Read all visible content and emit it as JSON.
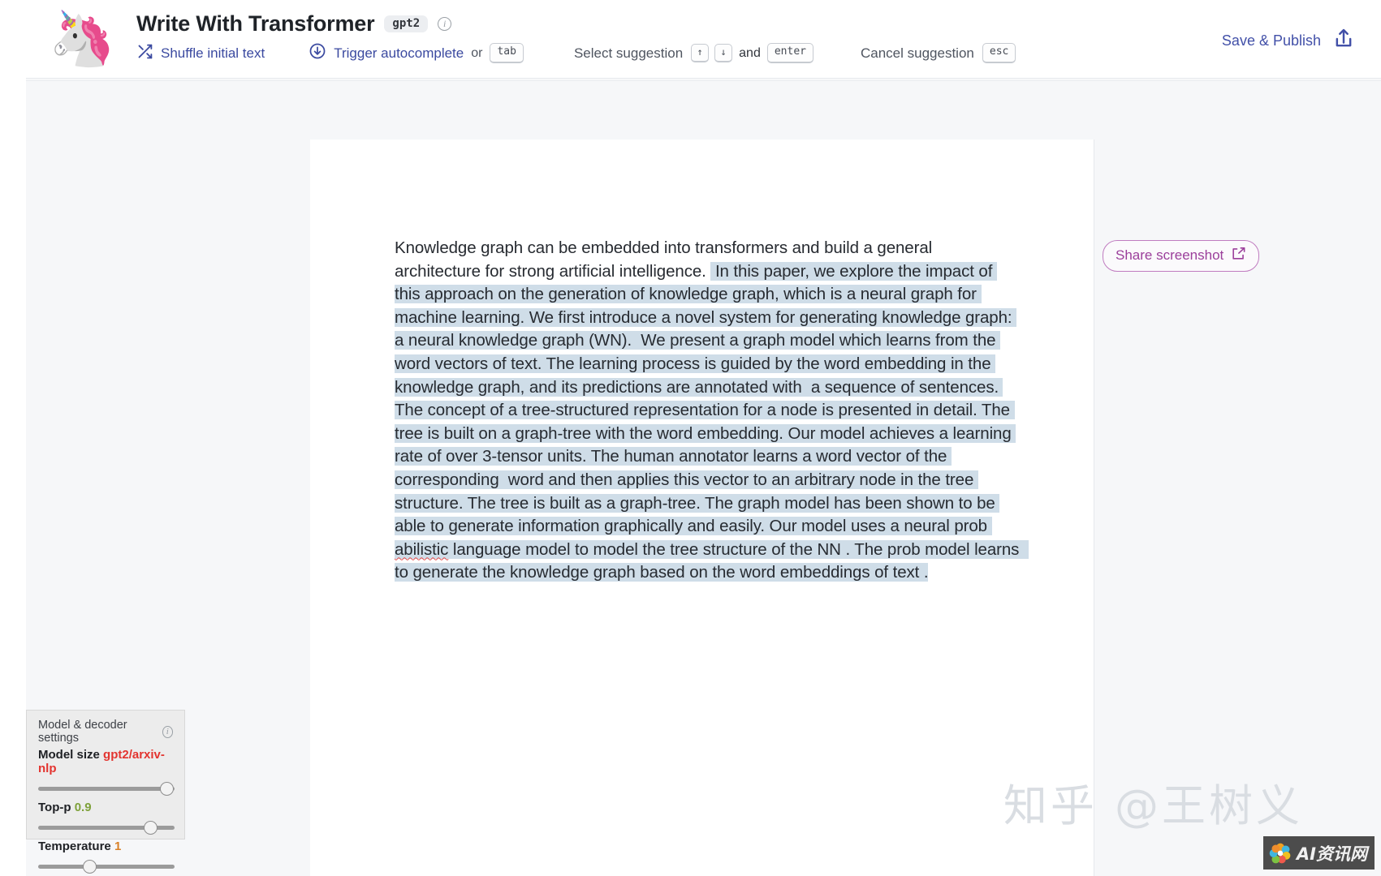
{
  "header": {
    "logo_emoji": "🦄",
    "title": "Write With Transformer",
    "model_chip": "gpt2",
    "info_glyph": "i",
    "hints": [
      {
        "icon": "shuffle-icon",
        "label": "Shuffle initial text",
        "keys": []
      },
      {
        "icon": "download-circle-icon",
        "label": "Trigger autocomplete",
        "connector": "or",
        "keys": [
          "tab"
        ]
      },
      {
        "icon": "",
        "label": "Select suggestion",
        "keys": [
          "↑",
          "↓"
        ],
        "connector2": "and",
        "keys2": [
          "enter"
        ]
      },
      {
        "icon": "",
        "label": "Cancel suggestion",
        "keys": [
          "esc"
        ]
      }
    ],
    "hint_or": "or",
    "hint_and": "and",
    "save_publish": "Save & Publish"
  },
  "editor": {
    "prompt_text": "Knowledge graph can be embedded into transformers and build a general architecture for strong artificial intelligence. ",
    "generated_part_1": " In this paper, we explore the impact of this approach on the generation of knowledge graph, which is a neural graph for machine learning. We first introduce a novel system for generating knowledge graph: a neural knowledge graph (WN).  We present a graph model which learns from the word vectors of text. The learning process is guided by the word embedding in the knowledge graph, and its predictions are annotated with  a sequence of sentences. The concept of a tree-structured representation for a node is presented in detail. The tree is built on a graph-tree with the word embedding. Our model achieves a learning rate of over 3-tensor units. The human annotator learns a word vector of the corresponding  word and then applies this vector to an arbitrary node in the tree structure. The tree is built as a graph-tree. The graph model has been shown to be able to generate information graphically and easily. Our model uses a neural prob ",
    "misspelled_word": "abilistic",
    "generated_part_2": " language model to model the tree structure of the NN . The prob model learns  to generate the knowledge graph based on the word embeddings of text ."
  },
  "share": {
    "label": "Share screenshot",
    "icon": "external-link-icon"
  },
  "settings": {
    "panel_title": "Model & decoder settings",
    "info_glyph": "i",
    "items": [
      {
        "label": "Model size",
        "value": "gpt2/arxiv-nlp",
        "value_color": "#e3342f",
        "thumb_pct": 100
      },
      {
        "label": "Top-p",
        "value": "0.9",
        "value_color": "#7ea13a",
        "thumb_pct": 88
      },
      {
        "label": "Temperature",
        "value": "1",
        "value_color": "#d98027",
        "thumb_pct": 37
      }
    ]
  },
  "watermarks": {
    "zhihu": "知乎 @王树义",
    "ai_site": "AI资讯网"
  },
  "colors": {
    "accent_blue": "#3b4aa0",
    "generated_highlight": "#cfdde8",
    "share_purple": "#9b3f9b",
    "page_bg": "#f6f7f9"
  }
}
